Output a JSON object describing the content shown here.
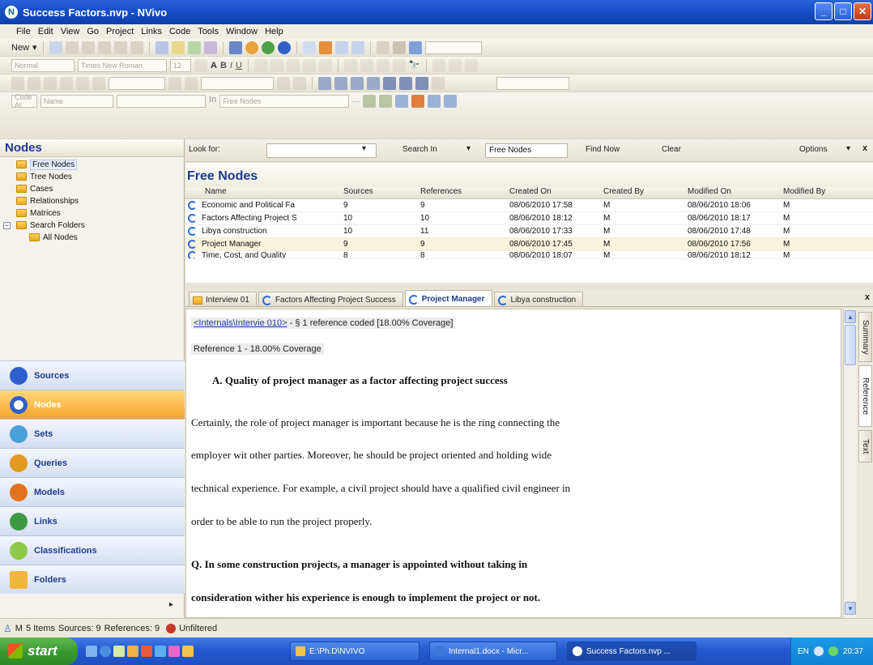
{
  "window": {
    "title": "Success Factors.nvp - NVivo",
    "app_icon": "N"
  },
  "menu": [
    "File",
    "Edit",
    "View",
    "Go",
    "Project",
    "Links",
    "Code",
    "Tools",
    "Window",
    "Help"
  ],
  "toolbar": {
    "new_label": "New",
    "style_combo": "Normal",
    "font_combo": "Times New Roman",
    "size_combo": "12",
    "code_at_label": "Code At",
    "code_at_name": "Name",
    "in_label": "In",
    "in_value": "Free Nodes"
  },
  "left_panel": {
    "title": "Nodes",
    "tree": [
      "Free Nodes",
      "Tree Nodes",
      "Cases",
      "Relationships",
      "Matrices",
      "Search Folders",
      "All Nodes"
    ],
    "nav": [
      "Sources",
      "Nodes",
      "Sets",
      "Queries",
      "Models",
      "Links",
      "Classifications",
      "Folders"
    ]
  },
  "search_bar": {
    "look_for_label": "Look for:",
    "look_for_value": "",
    "search_in_label": "Search In",
    "search_in_value": "Free Nodes",
    "find_now_label": "Find Now",
    "clear_label": "Clear",
    "options_label": "Options",
    "close_glyph": "x"
  },
  "node_list": {
    "title": "Free Nodes",
    "columns": [
      "Name",
      "Sources",
      "References",
      "Created On",
      "Created By",
      "Modified On",
      "Modified By"
    ],
    "rows": [
      [
        "Economic and Political Fa",
        "9",
        "9",
        "08/06/2010 17:58",
        "M",
        "08/06/2010 18:06",
        "M"
      ],
      [
        "Factors Affecting Project S",
        "10",
        "10",
        "08/06/2010 18:12",
        "M",
        "08/06/2010 18:17",
        "M"
      ],
      [
        "Libya construction",
        "10",
        "11",
        "08/06/2010 17:33",
        "M",
        "08/06/2010 17:48",
        "M"
      ],
      [
        "Project Manager",
        "9",
        "9",
        "08/06/2010 17:45",
        "M",
        "08/06/2010 17:56",
        "M"
      ],
      [
        "Time, Cost, and Quality",
        "8",
        "8",
        "08/06/2010 18:07",
        "M",
        "08/06/2010 18:12",
        "M"
      ]
    ]
  },
  "doc_tabs": [
    "Interview 01",
    "Factors Affecting Project Success",
    "Project Manager",
    "Libya construction"
  ],
  "doc_close_glyph": "x",
  "document": {
    "ref_link": "<Internals\\Intervie 010>",
    "ref_meta": " - § 1 reference coded  [18.00% Coverage]",
    "coverage": "Reference 1 - 18.00% Coverage",
    "heading": "A.  Quality of project manager as a factor affecting project success",
    "lines": [
      "Certainly, the role of project manager is important because he is the ring connecting the",
      "employer wit other parties. Moreover, he should be project oriented and holding wide",
      "technical experience. For example, a civil project should have a qualified civil engineer in",
      "order to be able to run the project properly."
    ],
    "question_lines": [
      "Q.  In  some  construction  projects,  a  manager  is  appointed  without  taking  in",
      "consideration  wither  his  experience  is  enough  to  implement  the  project  or  not."
    ]
  },
  "side_tabs": [
    "Summary",
    "Reference",
    "Text"
  ],
  "status": {
    "user": "M",
    "items": "5 Items",
    "sources": "Sources: 9",
    "references": "References: 9",
    "filter": "Unfiltered"
  },
  "taskbar": {
    "start_label": "start",
    "items": [
      "E:\\Ph.D\\NVIVO",
      "Internal1.docx - Micr...",
      "Success Factors.nvp ..."
    ],
    "lang": "EN",
    "clock": "20:37"
  },
  "colors": {
    "accent": "#1b3b8b",
    "titlebar": "#1750c8",
    "selected_nav": "#f7a52a",
    "alt_row": "#f7f3dd"
  }
}
